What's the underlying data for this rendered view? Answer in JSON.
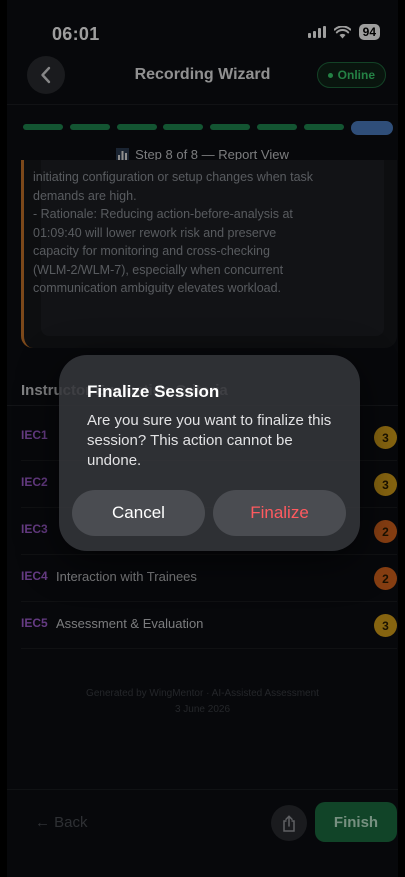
{
  "status_bar": {
    "time": "06:01",
    "battery": "94"
  },
  "header": {
    "title": "Recording Wizard",
    "status": "Online"
  },
  "progress": {
    "current_step": 8,
    "total_steps": 8,
    "label": "Step 8 of 8 — Report View"
  },
  "report": {
    "text": "initiating configuration or setup changes when task\ndemands are high.\n   - Rationale: Reducing action-before-analysis at\n01:09:40 will lower rework risk and preserve\ncapacity for monitoring and cross-checking\n(WLM-2/WLM-7), especially when concurrent\ncommunication ambiguity elevates workload."
  },
  "section": {
    "title": "Instructor Evaluation Criteria"
  },
  "criteria": [
    {
      "code": "IEC1",
      "name": "",
      "score": "3",
      "color": "#d9a21b"
    },
    {
      "code": "IEC2",
      "name": "",
      "score": "3",
      "color": "#d9a21b"
    },
    {
      "code": "IEC3",
      "name": "",
      "score": "2",
      "color": "#d9641e"
    },
    {
      "code": "IEC4",
      "name": "Interaction with Trainees",
      "score": "2",
      "color": "#d9641e"
    },
    {
      "code": "IEC5",
      "name": "Assessment & Evaluation",
      "score": "3",
      "color": "#d9a21b"
    }
  ],
  "footer": {
    "generated": "Generated by WingMentor · AI-Assisted Assessment",
    "date": "3 June 2026"
  },
  "bottom_bar": {
    "back": "← Back",
    "finish": "Finish"
  },
  "dialog": {
    "title": "Finalize Session",
    "message": "Are you sure you want to finalize this session? This action cannot be undone.",
    "cancel": "Cancel",
    "confirm": "Finalize"
  },
  "colors": {
    "accent_green": "#1f8a52",
    "active_step": "#4d7fc4",
    "card_border": "#c8742a",
    "code_purple": "#a35fd4",
    "destructive": "#ff5a5f"
  }
}
